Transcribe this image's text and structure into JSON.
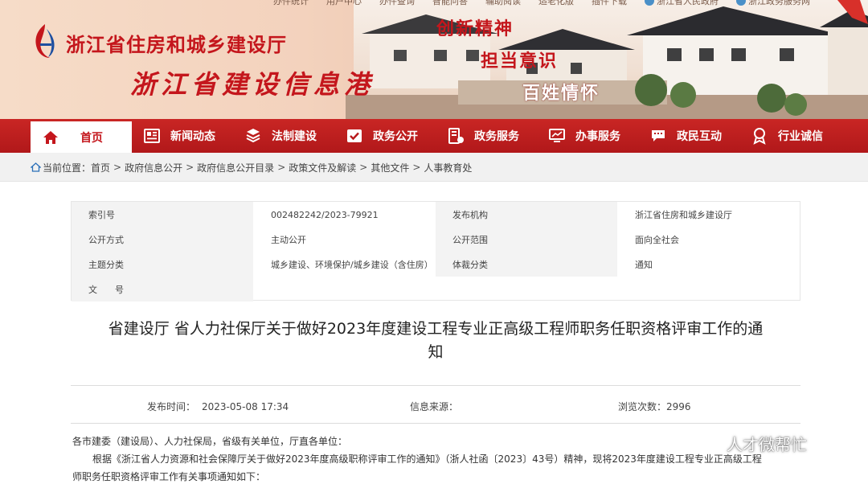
{
  "top_links": [
    "办件统计",
    "用户中心",
    "办件查询",
    "智能问答",
    "辅助阅读",
    "适老化版",
    "插件下载",
    "浙江省人民政府",
    "浙江政务服务网"
  ],
  "header": {
    "dept_name": "浙江省住房和城乡建设厅",
    "site_name": "浙江省建设信息港",
    "slogans": [
      "创新精神",
      "担当意识",
      "百姓情怀"
    ]
  },
  "nav": {
    "items": [
      {
        "label": "首页",
        "icon": "home-icon",
        "active": true
      },
      {
        "label": "新闻动态",
        "icon": "newspaper-icon"
      },
      {
        "label": "法制建设",
        "icon": "law-icon"
      },
      {
        "label": "政务公开",
        "icon": "document-check-icon"
      },
      {
        "label": "政务服务",
        "icon": "service-icon"
      },
      {
        "label": "办事服务",
        "icon": "monitor-icon"
      },
      {
        "label": "政民互动",
        "icon": "chat-icon"
      },
      {
        "label": "行业诚信",
        "icon": "credit-icon"
      }
    ]
  },
  "breadcrumb": {
    "prefix": "当前位置：",
    "items": [
      "首页",
      "政府信息公开",
      "政府信息公开目录",
      "政策文件及解读",
      "其他文件",
      "人事教育处"
    ]
  },
  "info_table": {
    "rows": [
      {
        "l1": "索引号",
        "v1": "002482242/2023-79921",
        "l2": "发布机构",
        "v2": "浙江省住房和城乡建设厅"
      },
      {
        "l1": "公开方式",
        "v1": "主动公开",
        "l2": "公开范围",
        "v2": "面向全社会"
      },
      {
        "l1": "主题分类",
        "v1": "城乡建设、环境保护/城乡建设（含住房）",
        "l2": "体裁分类",
        "v2": "通知"
      },
      {
        "l1": "文　　号",
        "v1": "",
        "l2": "",
        "v2": ""
      }
    ]
  },
  "article": {
    "title_line1": "省建设厅 省人力社保厅关于做好2023年度建设工程专业正高级工程师职务任职资格评审工作的通",
    "title_line2": "知",
    "publish_label": "发布时间：",
    "publish_time": "2023-05-08 17:34",
    "source_label": "信息来源：",
    "source_value": "",
    "views_label": "浏览次数：",
    "views_count": "2996",
    "salutation": "各市建委（建设局）、人力社保局，省级有关单位，厅直各单位：",
    "para1_line1": "根据《浙江省人力资源和社会保障厅关于做好2023年度高级职称评审工作的通知》（浙人社函〔2023〕43号）精神，现将2023年度建设工程专业正高级工程",
    "para1_line2": "师职务任职资格评审工作有关事项通知如下："
  },
  "watermark": {
    "text": "人才微帮忙",
    "icon": "wechat-icon"
  },
  "colors": {
    "brand_red": "#c4161c",
    "nav_red": "#b8191b",
    "breadcrumb_bg": "#f1f1f1"
  }
}
